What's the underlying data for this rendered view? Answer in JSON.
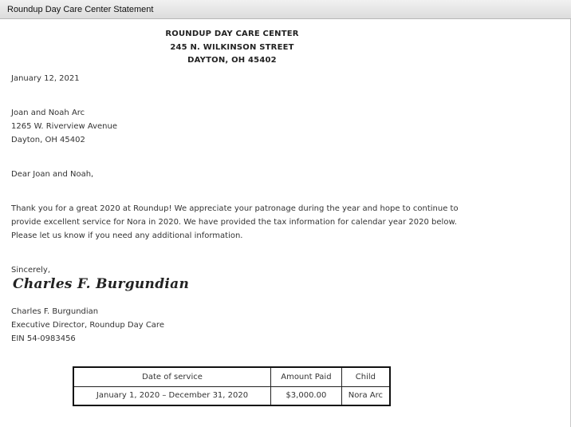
{
  "window": {
    "title": "Roundup Day Care Center Statement"
  },
  "header": {
    "name": "ROUNDUP DAY CARE CENTER",
    "street": "245 N. WILKINSON STREET",
    "city": "DAYTON, OH 45402"
  },
  "letter": {
    "date": "January 12, 2021",
    "recipient": {
      "name": "Joan and Noah Arc",
      "street": "1265 W. Riverview Avenue",
      "city": "Dayton, OH 45402"
    },
    "greeting": "Dear Joan and Noah,",
    "body": [
      "Thank you for a great 2020 at Roundup! We appreciate your patronage during the year and hope to continue to",
      "provide excellent service for Nora in 2020. We have provided the tax information for calendar year 2020 below.",
      "Please let us know if you need any additional information."
    ],
    "closing": "Sincerely,",
    "signature": "Charles F. Burgundian",
    "sender": {
      "name": "Charles F. Burgundian",
      "title": "Executive Director, Roundup Day Care",
      "ein": "EIN 54-0983456"
    }
  },
  "table": {
    "headers": [
      "Date of service",
      "Amount Paid",
      "Child"
    ],
    "rows": [
      [
        "January 1, 2020 – December 31, 2020",
        "$3,000.00",
        "Nora Arc"
      ]
    ]
  }
}
